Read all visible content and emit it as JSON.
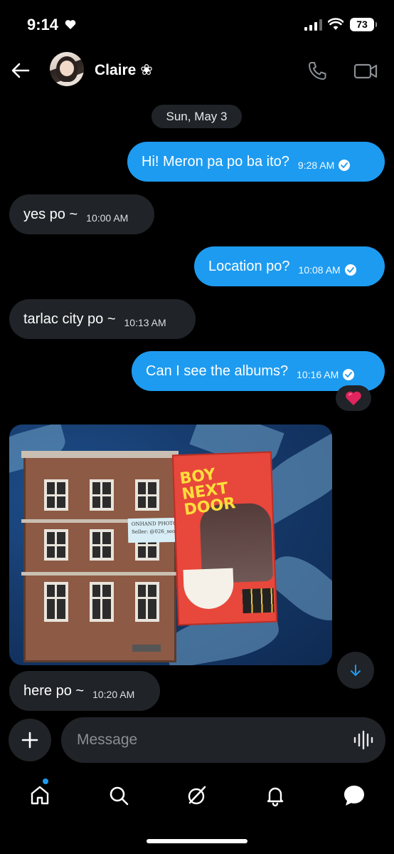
{
  "status_bar": {
    "time": "9:14",
    "battery": "73"
  },
  "header": {
    "contact_name": "Claire ❀"
  },
  "date_separator": "Sun, May 3",
  "messages": [
    {
      "direction": "out",
      "text": "Hi! Meron pa po ba ito?",
      "time": "9:28 AM"
    },
    {
      "direction": "in",
      "text": "yes po ~",
      "time": "10:00 AM"
    },
    {
      "direction": "out",
      "text": "Location po?",
      "time": "10:08 AM"
    },
    {
      "direction": "in",
      "text": "tarlac city po ~",
      "time": "10:13 AM"
    },
    {
      "direction": "out",
      "text": "Can I see the albums?",
      "time": "10:16 AM"
    },
    {
      "direction": "in",
      "text": "here po ~",
      "time": "10:20 AM"
    }
  ],
  "reaction": "❤️",
  "photo": {
    "note_line1": "ONHAND PHOTO PROOF",
    "note_line2": "Seller: @026_seoulcutie (claire)",
    "album_title": "BOY NEXT DOOR"
  },
  "composer": {
    "placeholder": "Message"
  },
  "nav": {
    "home_has_badge": true
  },
  "colors": {
    "accent": "#1d9bf0",
    "bubble_in": "#202327",
    "background": "#000000"
  }
}
